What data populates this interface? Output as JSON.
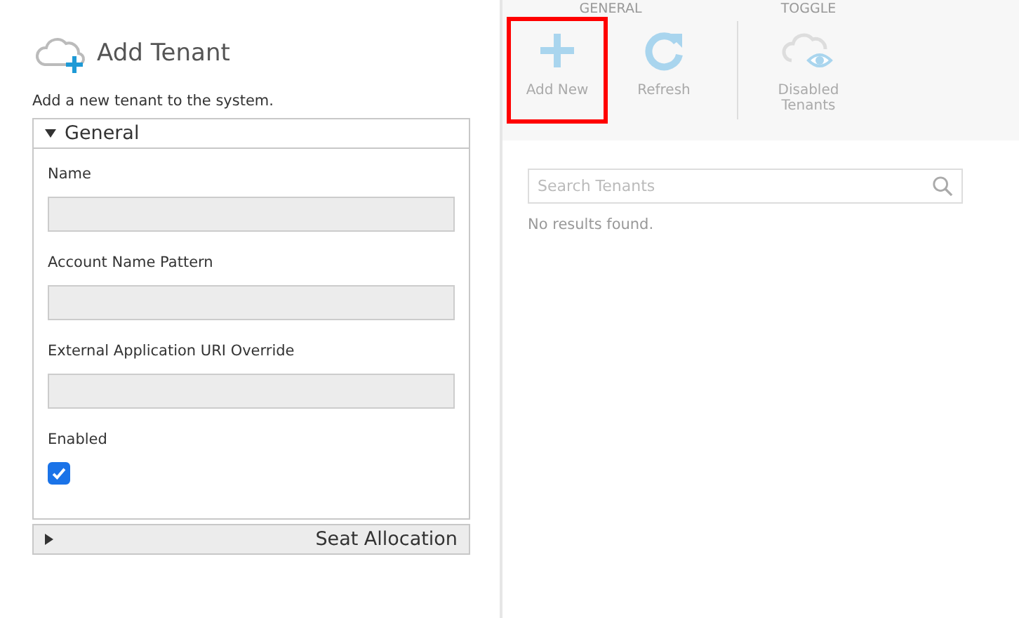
{
  "form": {
    "title": "Add Tenant",
    "description": "Add a new tenant to the system.",
    "sections": [
      {
        "title": "General",
        "expanded": true,
        "fields": [
          {
            "kind": "text",
            "label": "Name"
          },
          {
            "kind": "text",
            "label": "Account Name Pattern"
          },
          {
            "kind": "text",
            "label": "External Application URI Override"
          },
          {
            "kind": "checkbox",
            "label": "Enabled",
            "checked": true
          }
        ]
      },
      {
        "title": "Seat Allocation",
        "expanded": false
      }
    ]
  },
  "toolbar": {
    "groups": [
      {
        "title": "GENERAL",
        "buttons": [
          {
            "kind": "add",
            "label": "Add New",
            "highlighted": true
          },
          {
            "kind": "refresh",
            "label": "Refresh",
            "highlighted": false
          }
        ]
      },
      {
        "title": "TOGGLE",
        "buttons": [
          {
            "kind": "disabled-tenants",
            "label": "Disabled Tenants",
            "highlighted": false
          }
        ]
      }
    ]
  },
  "search": {
    "placeholder": "Search Tenants"
  },
  "results_message": "No results found."
}
